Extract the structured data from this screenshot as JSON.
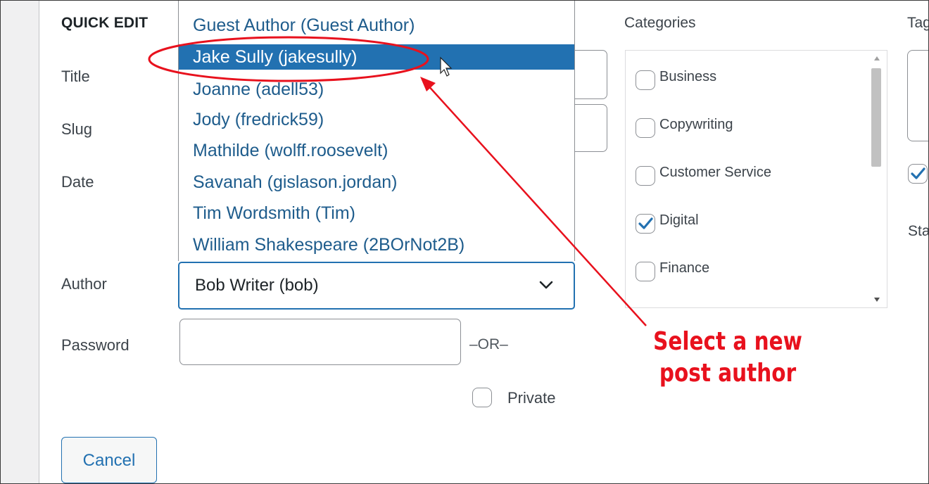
{
  "form": {
    "section_title": "QUICK EDIT",
    "labels": {
      "title": "Title",
      "slug": "Slug",
      "date": "Date",
      "author": "Author",
      "password": "Password"
    },
    "author_select": {
      "selected_value": "Bob Writer (bob)",
      "options": [
        "Guest Author (Guest Author)",
        "Jake Sully (jakesully)",
        "Joanne (adell53)",
        "Jody (fredrick59)",
        "Mathilde (wolff.roosevelt)",
        "Savanah (gislason.jordan)",
        "Tim Wordsmith (Tim)",
        "William Shakespeare (2BOrNot2B)"
      ],
      "highlighted_option": "Jake Sully (jakesully)"
    },
    "password_value": "",
    "or_text": "–OR–",
    "private_label": "Private",
    "private_checked": false,
    "cancel_label": "Cancel"
  },
  "categories": {
    "title": "Categories",
    "items": [
      {
        "name": "Business",
        "checked": false
      },
      {
        "name": "Copywriting",
        "checked": false
      },
      {
        "name": "Customer Service",
        "checked": false
      },
      {
        "name": "Digital",
        "checked": true
      },
      {
        "name": "Finance",
        "checked": false
      }
    ]
  },
  "tags": {
    "title": "Tag",
    "checkbox_checked": true
  },
  "status": {
    "title": "Sta"
  },
  "annotation": {
    "callout_line1": "Select a new",
    "callout_line2": "post author",
    "color": "#e8111d"
  },
  "colors": {
    "accent": "#2271b1",
    "link": "#1e5c8c"
  }
}
